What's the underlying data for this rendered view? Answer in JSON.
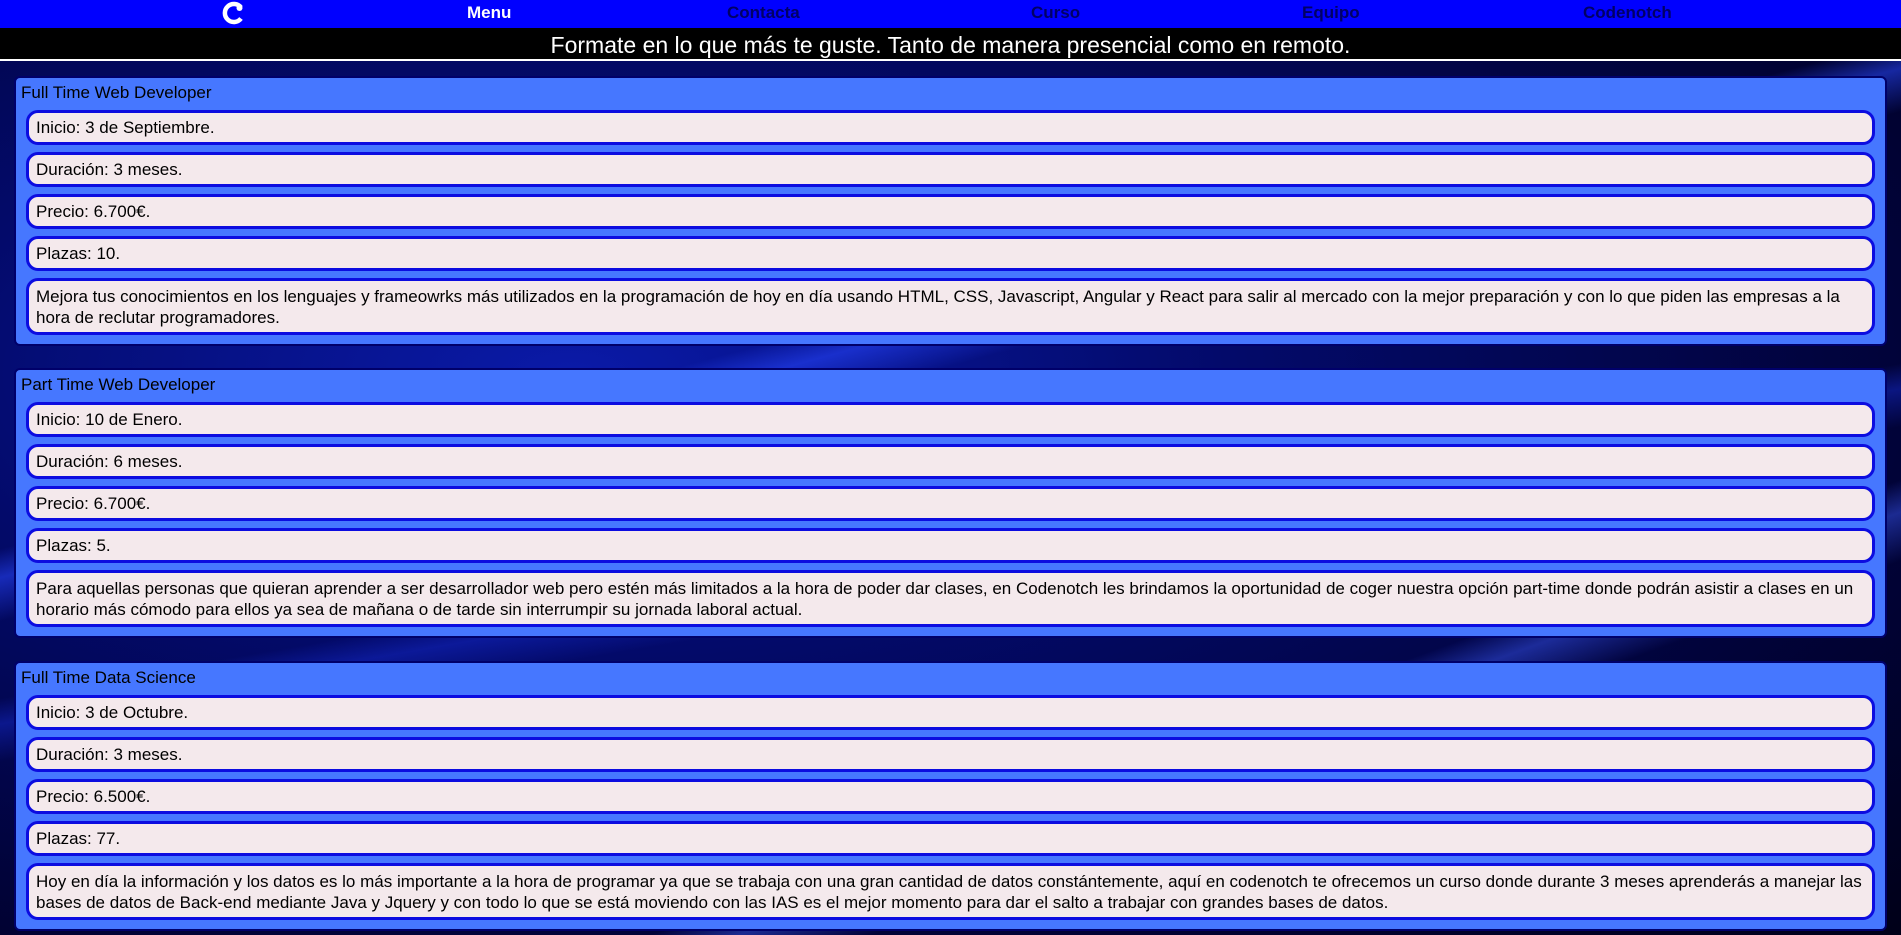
{
  "nav": {
    "logo_icon": "codenotch-c-logo-icon",
    "menu_label": "Menu",
    "contacta_label": "Contacta",
    "curso_label": "Curso",
    "equipo_label": "Equipo",
    "codenotch_label": "Codenotch"
  },
  "tagline": "Formate en lo que más te guste. Tanto de manera presencial como en remoto.",
  "courses": [
    {
      "title": "Full Time Web Developer",
      "inicio": "Inicio: 3 de Septiembre.",
      "duracion": "Duración: 3 meses.",
      "precio": "Precio: 6.700€.",
      "plazas": "Plazas: 10.",
      "descripcion": "Mejora tus conocimientos en los lenguajes y frameowrks más utilizados en la programación de hoy en día usando HTML, CSS, Javascript, Angular y React para salir al mercado con la mejor preparación y con lo que piden las empresas a la hora de reclutar programadores."
    },
    {
      "title": "Part Time Web Developer",
      "inicio": "Inicio: 10 de Enero.",
      "duracion": "Duración: 6 meses.",
      "precio": "Precio: 6.700€.",
      "plazas": "Plazas: 5.",
      "descripcion": "Para aquellas personas que quieran aprender a ser desarrollador web pero estén más limitados a la hora de poder dar clases, en Codenotch les brindamos la oportunidad de coger nuestra opción part-time donde podrán asistir a clases en un horario más cómodo para ellos ya sea de mañana o de tarde sin interrumpir su jornada laboral actual."
    },
    {
      "title": "Full Time Data Science",
      "inicio": "Inicio: 3 de Octubre.",
      "duracion": "Duración: 3 meses.",
      "precio": "Precio: 6.500€.",
      "plazas": "Plazas: 77.",
      "descripcion": "Hoy en día la información y los datos es lo más importante a la hora de programar ya que se trabaja con una gran cantidad de datos constántemente, aquí en codenotch te ofrecemos un curso donde durante 3 meses aprenderás a manejar las bases de datos de Back-end mediante Java y Jquery y con todo lo que se está moviendo con las IAS es el mejor momento para dar el salto a trabajar con grandes bases de datos."
    }
  ],
  "colors": {
    "navbar": "#0000ff",
    "card_background": "#4677ff",
    "field_background": "#f4e9ec",
    "field_border": "#0c0ce0"
  }
}
